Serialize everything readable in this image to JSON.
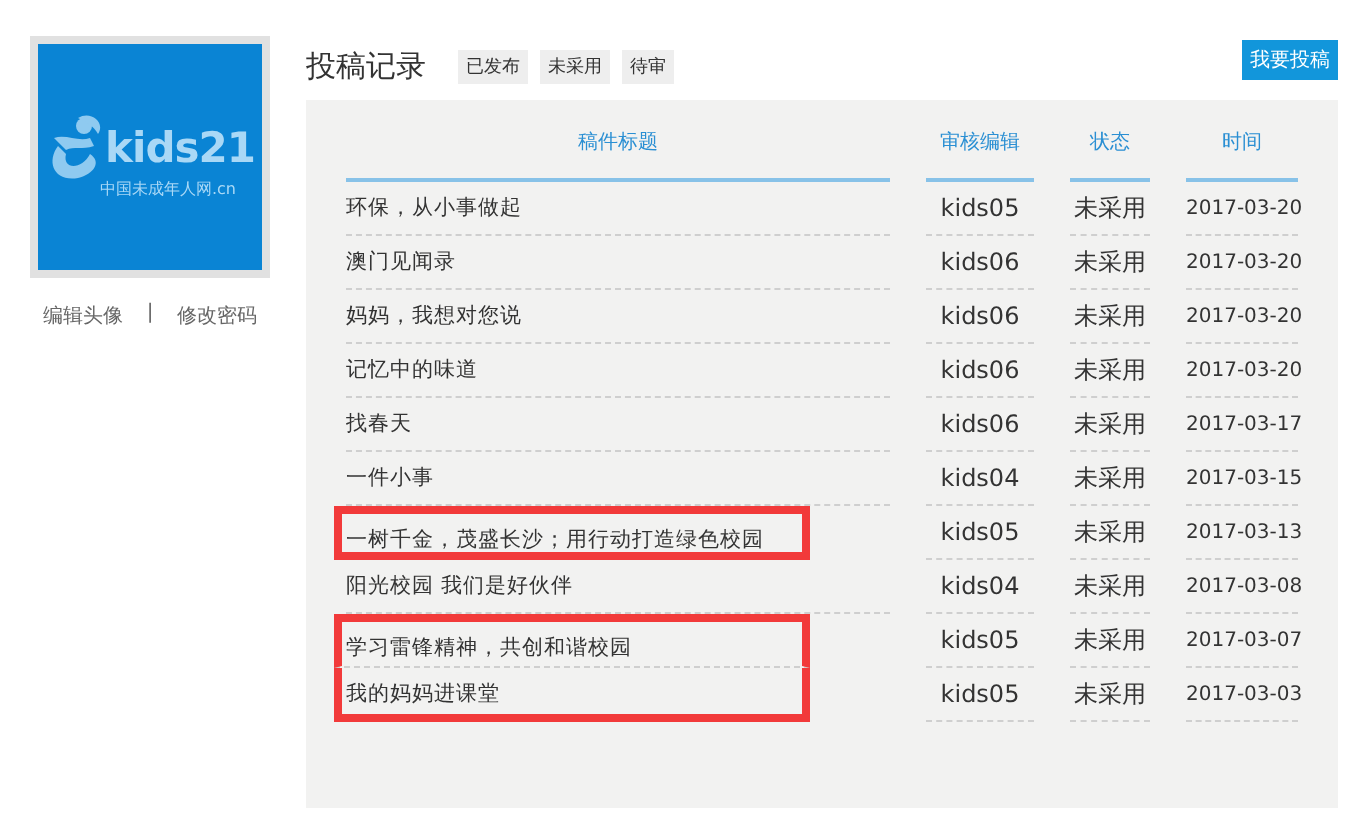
{
  "profile": {
    "logo": {
      "name": "kids21",
      "tagline": "中国未成年人网.cn"
    },
    "links": [
      "编辑头像",
      "修改密码"
    ],
    "separator": "|"
  },
  "header": {
    "title": "投稿记录",
    "filters": [
      {
        "label": "已发布",
        "selected": false
      },
      {
        "label": "未采用",
        "selected": false
      },
      {
        "label": "待审",
        "selected": false
      }
    ],
    "action": "我要投稿"
  },
  "table": {
    "columns": [
      "稿件标题",
      "审核编辑",
      "状态",
      "时间"
    ],
    "rows": [
      {
        "title": "环保，从小事做起",
        "editor": "kids05",
        "status": "未采用",
        "time": "2017-03-20",
        "highlighted": false
      },
      {
        "title": "澳门见闻录",
        "editor": "kids06",
        "status": "未采用",
        "time": "2017-03-20",
        "highlighted": false
      },
      {
        "title": "妈妈，我想对您说",
        "editor": "kids06",
        "status": "未采用",
        "time": "2017-03-20",
        "highlighted": false
      },
      {
        "title": "记忆中的味道",
        "editor": "kids06",
        "status": "未采用",
        "time": "2017-03-20",
        "highlighted": false
      },
      {
        "title": "找春天",
        "editor": "kids06",
        "status": "未采用",
        "time": "2017-03-17",
        "highlighted": false
      },
      {
        "title": "一件小事",
        "editor": "kids04",
        "status": "未采用",
        "time": "2017-03-15",
        "highlighted": false
      },
      {
        "title": "一树千金，茂盛长沙；用行动打造绿色校园",
        "editor": "kids05",
        "status": "未采用",
        "time": "2017-03-13",
        "highlighted": true
      },
      {
        "title": "阳光校园 我们是好伙伴",
        "editor": "kids04",
        "status": "未采用",
        "time": "2017-03-08",
        "highlighted": false
      },
      {
        "title": "学习雷锋精神，共创和谐校园",
        "editor": "kids05",
        "status": "未采用",
        "time": "2017-03-07",
        "highlighted": true
      },
      {
        "title": "我的妈妈进课堂",
        "editor": "kids05",
        "status": "未采用",
        "time": "2017-03-03",
        "highlighted": true
      }
    ]
  }
}
